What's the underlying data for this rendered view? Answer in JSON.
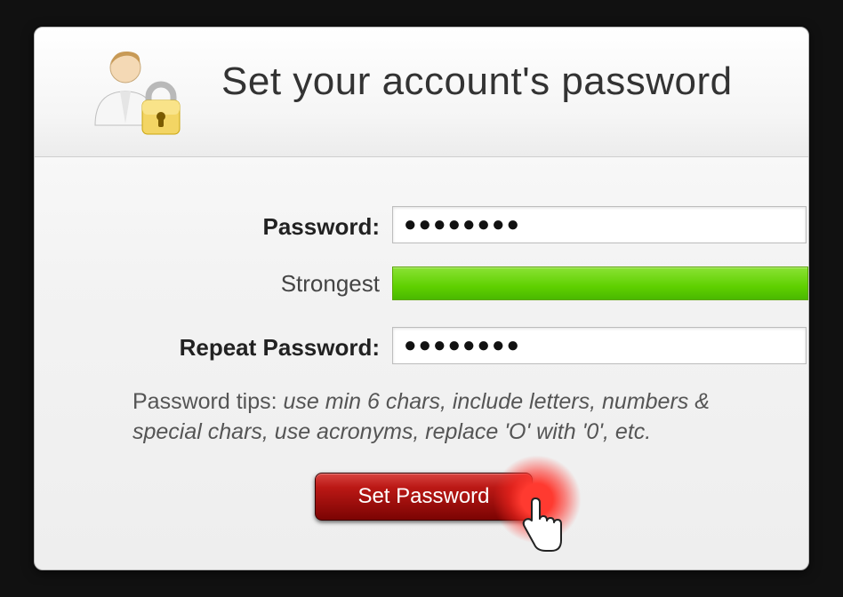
{
  "header": {
    "title": "Set your account's password"
  },
  "form": {
    "password_label": "Password:",
    "password_value": "●●●●●●●●",
    "strength_label": "Strongest",
    "strength_color": "#5fd000",
    "repeat_label": "Repeat Password:",
    "repeat_value": "●●●●●●●●"
  },
  "tips": {
    "prefix": "Password tips: ",
    "body": "use min 6 chars, include letters, numbers & special chars, use acronyms, replace 'O' with '0', etc."
  },
  "submit": {
    "label": "Set Password"
  }
}
